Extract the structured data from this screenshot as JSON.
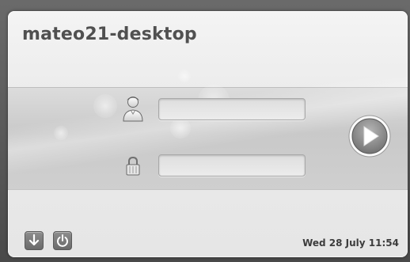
{
  "login": {
    "hostname": "mateo21-desktop",
    "username_value": "",
    "password_value": ""
  },
  "icons": {
    "user": "user-icon",
    "lock": "lock-icon",
    "login": "play-arrow-icon",
    "suspend": "down-arrow-icon",
    "shutdown": "power-icon"
  },
  "status": {
    "clock": "Wed 28 July 11:54"
  },
  "colors": {
    "panel": "#eeeeee",
    "band": "#cfcfcf",
    "text": "#505050",
    "button_gray": "#7a7a7a"
  }
}
